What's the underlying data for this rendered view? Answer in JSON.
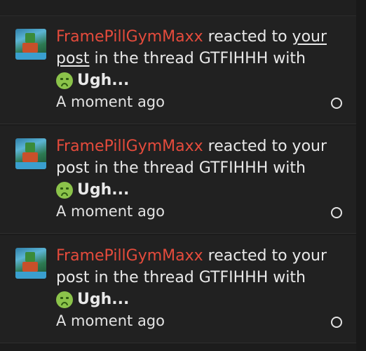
{
  "alerts": [
    {
      "username": "FramePillGymMaxx",
      "text_before": " reacted to ",
      "link": "your post",
      "text_after": " in the thread GTFIHHH with",
      "reaction_label": "Ugh...",
      "reaction_icon": "nauseated-face-icon",
      "time": "A moment ago"
    },
    {
      "username": "FramePillGymMaxx",
      "text_before": " reacted to ",
      "link": "your post",
      "text_after": " in the thread GTFIHHH with",
      "reaction_label": "Ugh...",
      "reaction_icon": "nauseated-face-icon",
      "time": "A moment ago"
    },
    {
      "username": "FramePillGymMaxx",
      "text_before": " reacted to ",
      "link": "your post",
      "text_after": " in the thread GTFIHHH with",
      "reaction_label": "Ugh...",
      "reaction_icon": "nauseated-face-icon",
      "time": "A moment ago"
    }
  ],
  "colors": {
    "background": "#1c1c1c",
    "username": "#e54b3c",
    "text": "#e9e9e9",
    "emoji": "#8bc34a"
  }
}
